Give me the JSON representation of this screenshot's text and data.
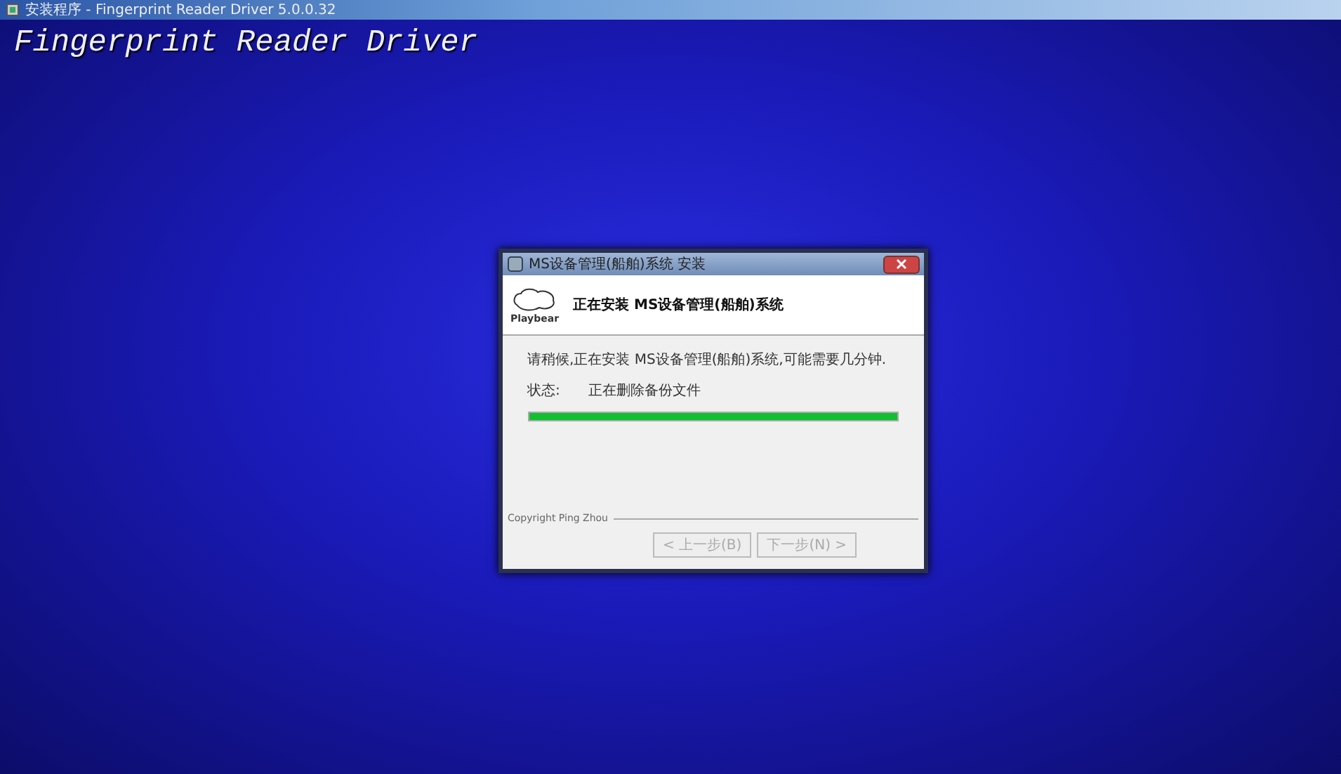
{
  "window": {
    "title": "安装程序 - Fingerprint Reader Driver 5.0.0.32"
  },
  "banner": "Fingerprint Reader Driver",
  "dialog": {
    "title": "MS设备管理(船舶)系统 安装",
    "logo_text": "Playbear",
    "heading": "正在安装 MS设备管理(船舶)系统",
    "message": "请稍候,正在安装 MS设备管理(船舶)系统,可能需要几分钟.",
    "status_label": "状态:",
    "status_value": "正在删除备份文件",
    "progress": {
      "level": 1.0
    },
    "copyright": "Copyright Ping Zhou",
    "buttons": [
      {
        "label": "< 上一步(B)",
        "disabled": true
      },
      {
        "label": "下一步(N) >",
        "disabled": true
      }
    ]
  }
}
